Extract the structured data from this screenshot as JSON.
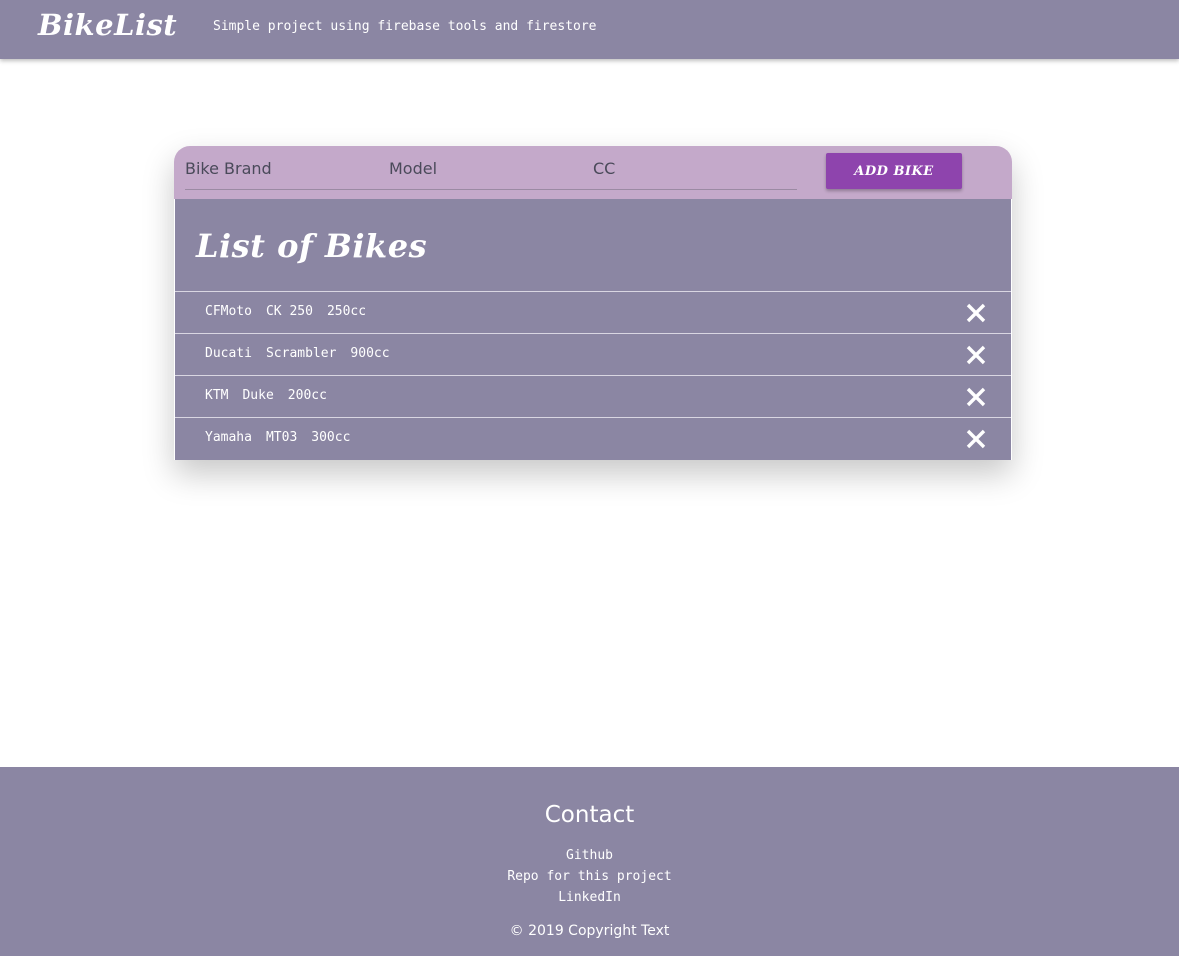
{
  "header": {
    "brand": "BikeList",
    "tagline": "Simple project using firebase tools and firestore"
  },
  "form": {
    "brand_placeholder": "Bike Brand",
    "model_placeholder": "Model",
    "cc_placeholder": "CC",
    "add_button_label": "Add Bike"
  },
  "list": {
    "title": "List of Bikes",
    "bikes": [
      {
        "brand": "CFMoto",
        "model": "CK 250",
        "cc": "250cc"
      },
      {
        "brand": "Ducati",
        "model": "Scrambler",
        "cc": "900cc"
      },
      {
        "brand": "KTM",
        "model": "Duke",
        "cc": "200cc"
      },
      {
        "brand": "Yamaha",
        "model": "MT03",
        "cc": "300cc"
      }
    ],
    "delete_icon": "close-icon"
  },
  "footer": {
    "heading": "Contact",
    "links": [
      "Github",
      "Repo for this project",
      "LinkedIn"
    ],
    "copyright": "© 2019 Copyright Text"
  },
  "colors": {
    "header_bg": "#8b86a3",
    "form_bg": "#c4a9ca",
    "button_bg": "#8e44ad",
    "list_bg": "#8b86a3",
    "footer_bg": "#8b86a3"
  }
}
